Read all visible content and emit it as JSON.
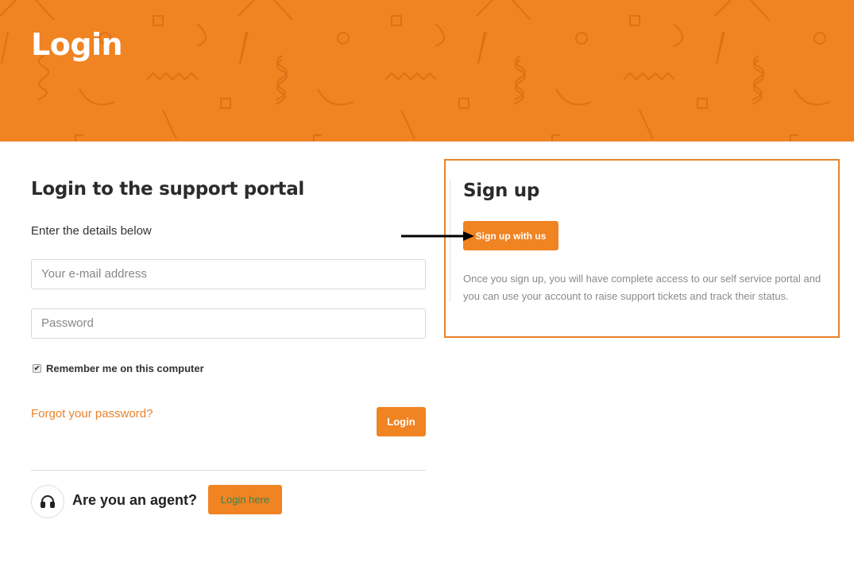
{
  "header": {
    "title": "Login"
  },
  "login": {
    "heading": "Login to the support portal",
    "subheading": "Enter the details below",
    "email_placeholder": "Your e-mail address",
    "password_placeholder": "Password",
    "remember_label": "Remember me on this computer",
    "remember_checked": true,
    "forgot_link": "Forgot your password?",
    "login_button": "Login"
  },
  "agent": {
    "prompt": "Are you an agent?",
    "button": "Login here",
    "icon": "headset-icon"
  },
  "signup": {
    "heading": "Sign up",
    "button": "Sign up with us",
    "description": "Once you sign up, you will have complete access to our self service portal and you can use your account to raise support tickets and track their status."
  },
  "colors": {
    "accent": "#f08322",
    "link": "#e8832a",
    "agent_button_text": "#2c8a5a"
  }
}
